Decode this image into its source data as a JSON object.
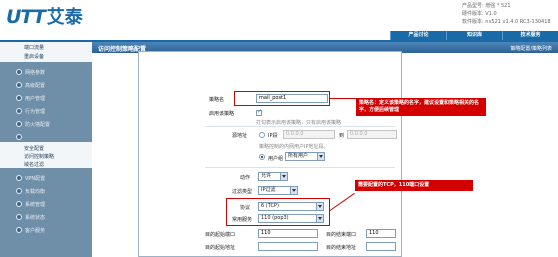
{
  "header": {
    "logo_latin": "UTT",
    "logo_cn": "艾泰",
    "info_lines": [
      "产品型号: 增强 * 521",
      "硬件版本: V1.0",
      "软件版本: nv521 v1.4.0 RC3-130418"
    ],
    "nav": [
      "产品讨论",
      "知识库",
      "技术服务"
    ]
  },
  "sidebar": {
    "top_items": [
      "端口流量",
      "重启设备"
    ],
    "items": [
      "网络参数",
      "高级配置",
      "用户管理",
      "行为管理",
      "防火墙配置",
      "",
      "VPN配置",
      "负载均衡",
      "系统管理",
      "系统状态",
      "客户服务"
    ],
    "expanded": [
      "安全配置",
      "访问控制策略",
      "域名过滤"
    ]
  },
  "main": {
    "title": "访问控制策略配置",
    "right_link": "策略配置/策略列表"
  },
  "form": {
    "policy_name_label": "策略名",
    "policy_name_value": "mail_post1",
    "enable_label": "启用该策略",
    "enable_hint": "打勾表示启用该策略，只有启用该策略",
    "source_label": "源地址",
    "ip_range_label": "IP段",
    "ip_from": "0.0.0.0",
    "to_label": "到",
    "ip_to": "0.0.0.0",
    "source_hint": "策略控制的内网用户IP地址段。",
    "user_group_label": "用户组",
    "user_group_value": "所有用户",
    "action_label": "动作",
    "action_value": "允许",
    "filter_type_label": "过滤类型",
    "filter_type_value": "IP过滤",
    "protocol_label": "协议",
    "protocol_value": "6 (TCP)",
    "service_label": "常用服务",
    "service_value": "110 (pop3)",
    "dst_port_start_label": "目的起始端口",
    "dst_port_start_value": "110",
    "dst_port_end_label": "目的结束端口",
    "dst_port_end_value": "110",
    "dst_addr_start_label": "目的起始地址",
    "dst_addr_end_label": "目的结束地址"
  },
  "annotations": {
    "note1": "策略名：定义该策略的名字，建议设置和策略相关的名字，方便后续管理",
    "note2": "需要配置的TCP，110端口设置"
  },
  "colors": {
    "brand": "#1a6aa8",
    "sidebar": "#6f8ea8",
    "annotation": "#d40000"
  }
}
